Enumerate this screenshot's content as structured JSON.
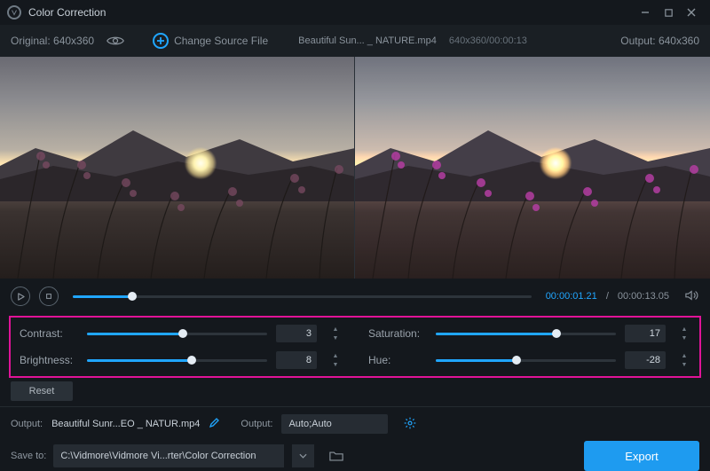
{
  "title": "Color Correction",
  "toolbar": {
    "original_label": "Original: 640x360",
    "change_source_label": "Change Source File",
    "file_name": "Beautiful Sun... _ NATURE.mp4",
    "dims_duration": "640x360/00:00:13",
    "output_label": "Output: 640x360"
  },
  "timeline": {
    "current": "00:00:01.21",
    "total": "00:00:13.05",
    "progress_pct": 13
  },
  "controls": {
    "contrast": {
      "label": "Contrast:",
      "value": "3",
      "slider_pct": 53
    },
    "brightness": {
      "label": "Brightness:",
      "value": "8",
      "slider_pct": 58
    },
    "saturation": {
      "label": "Saturation:",
      "value": "17",
      "slider_pct": 67
    },
    "hue": {
      "label": "Hue:",
      "value": "-28",
      "slider_pct": 45
    },
    "reset_label": "Reset"
  },
  "output": {
    "label1": "Output:",
    "filename": "Beautiful Sunr...EO _ NATUR.mp4",
    "label2": "Output:",
    "format": "Auto;Auto"
  },
  "save": {
    "label": "Save to:",
    "path": "C:\\Vidmore\\Vidmore Vi...rter\\Color Correction"
  },
  "export_label": "Export"
}
